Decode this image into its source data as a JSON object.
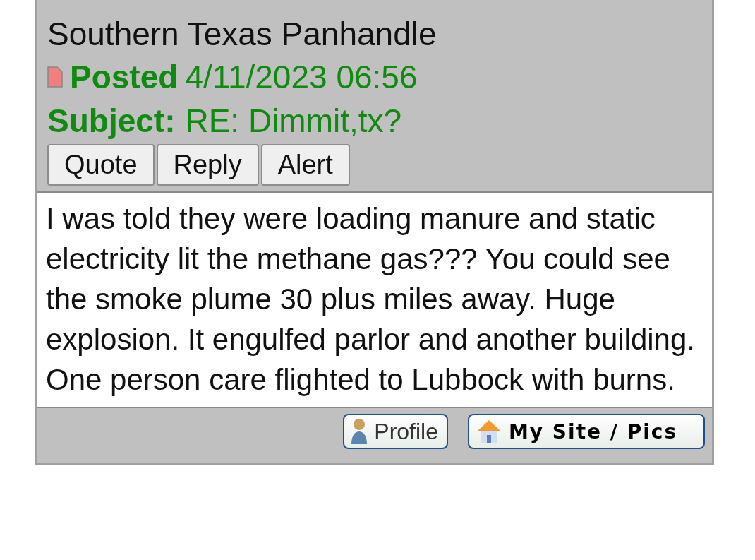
{
  "post": {
    "location": "Southern Texas Panhandle",
    "posted_label": "Posted",
    "posted_date": "4/11/2023 06:56",
    "subject_label": "Subject:",
    "subject": "RE: Dimmit,tx?",
    "actions": [
      "Quote",
      "Reply",
      "Alert"
    ],
    "body": "I was told they were loading manure and static electricity lit the methane gas??? You could see the smoke plume 30 plus miles away. Huge explosion. It engulfed parlor and another building. One person care flighted to Lubbock with burns.",
    "footer_buttons": [
      {
        "kind": "profile",
        "label": "Profile"
      },
      {
        "kind": "site",
        "label": "My Site / Pics"
      }
    ]
  }
}
